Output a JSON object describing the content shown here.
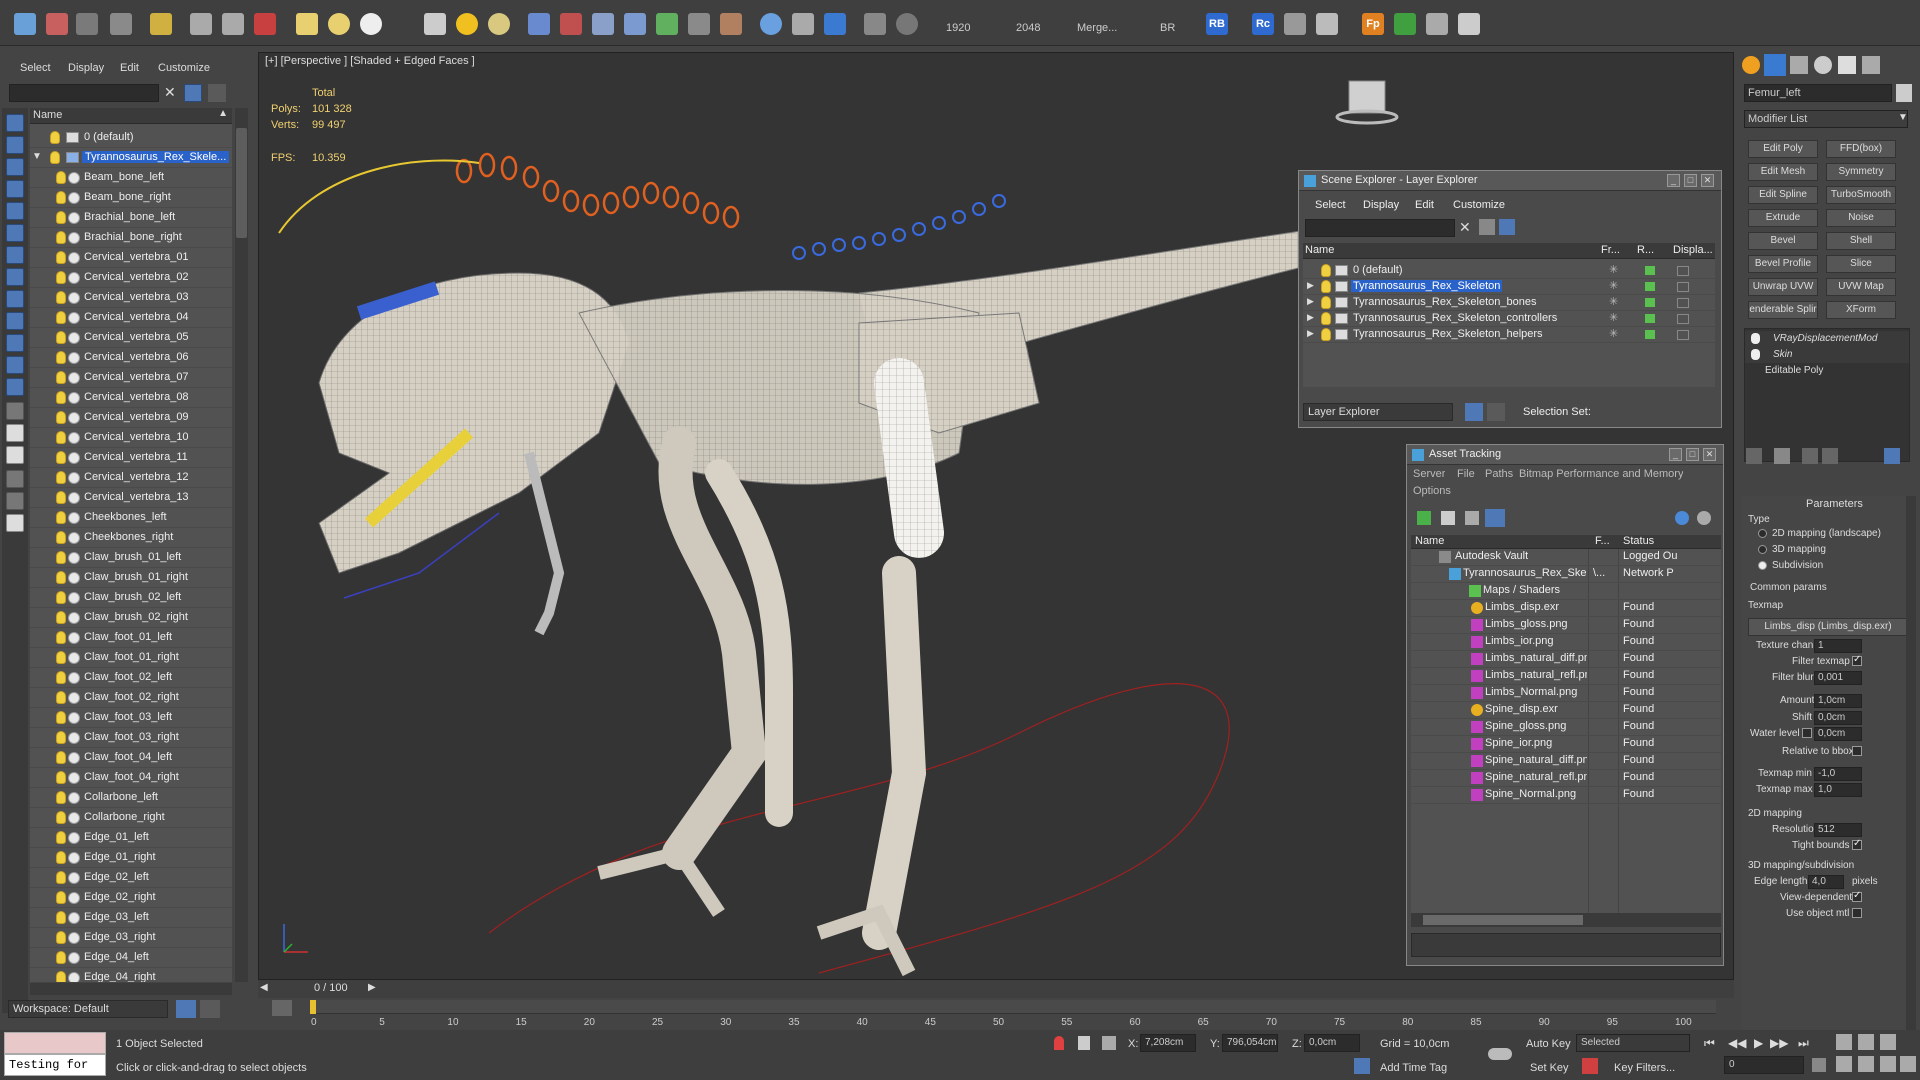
{
  "toolbar": {
    "render_width": "1920",
    "render_height": "2048",
    "merge_label": "Merge...",
    "br_label": "BR",
    "rb_label": "RB",
    "rc_label": "Rc",
    "fp_label": "Fp"
  },
  "scene_explorer_left": {
    "menu": [
      "Select",
      "Display",
      "Edit",
      "Customize"
    ],
    "column_name": "Name",
    "layer_default": "0 (default)",
    "selected_layer": "Tyrannosaurus_Rex_Skele...",
    "objects": [
      "Beam_bone_left",
      "Beam_bone_right",
      "Brachial_bone_left",
      "Brachial_bone_right",
      "Cervical_vertebra_01",
      "Cervical_vertebra_02",
      "Cervical_vertebra_03",
      "Cervical_vertebra_04",
      "Cervical_vertebra_05",
      "Cervical_vertebra_06",
      "Cervical_vertebra_07",
      "Cervical_vertebra_08",
      "Cervical_vertebra_09",
      "Cervical_vertebra_10",
      "Cervical_vertebra_11",
      "Cervical_vertebra_12",
      "Cervical_vertebra_13",
      "Cheekbones_left",
      "Cheekbones_right",
      "Claw_brush_01_left",
      "Claw_brush_01_right",
      "Claw_brush_02_left",
      "Claw_brush_02_right",
      "Claw_foot_01_left",
      "Claw_foot_01_right",
      "Claw_foot_02_left",
      "Claw_foot_02_right",
      "Claw_foot_03_left",
      "Claw_foot_03_right",
      "Claw_foot_04_left",
      "Claw_foot_04_right",
      "Collarbone_left",
      "Collarbone_right",
      "Edge_01_left",
      "Edge_01_right",
      "Edge_02_left",
      "Edge_02_right",
      "Edge_03_left",
      "Edge_03_right",
      "Edge_04_left",
      "Edge_04_right"
    ],
    "workspace": "Workspace: Default"
  },
  "viewport": {
    "label": "[+] [Perspective ] [Shaded + Edged Faces ]",
    "stats_total": "Total",
    "polys_label": "Polys:",
    "polys_value": "101 328",
    "verts_label": "Verts:",
    "verts_value": "99 497",
    "fps_label": "FPS:",
    "fps_value": "10.359",
    "frame_counter": "0 / 100"
  },
  "layer_explorer": {
    "title": "Scene Explorer - Layer Explorer",
    "menu": [
      "Select",
      "Display",
      "Edit",
      "Customize"
    ],
    "columns": [
      "Name",
      "Fr...",
      "R...",
      "Displa..."
    ],
    "layers": [
      "0 (default)",
      "Tyrannosaurus_Rex_Skeleton",
      "Tyrannosaurus_Rex_Skeleton_bones",
      "Tyrannosaurus_Rex_Skeleton_controllers",
      "Tyrannosaurus_Rex_Skeleton_helpers"
    ],
    "footer_dropdown": "Layer Explorer",
    "selection_set": "Selection Set:"
  },
  "asset_tracking": {
    "title": "Asset Tracking",
    "menu1": [
      "Server",
      "File",
      "Paths",
      "Bitmap Performance and Memory"
    ],
    "menu2": "Options",
    "columns": [
      "Name",
      "F...",
      "Status"
    ],
    "vault": "Autodesk Vault",
    "vault_status": "Logged Ou",
    "scene_file": "Tyrannosaurus_Rex_Skeleton....",
    "scene_path": "\\...",
    "scene_status": "Network P",
    "maps_group": "Maps / Shaders",
    "files": [
      {
        "name": "Limbs_disp.exr",
        "status": "Found",
        "kind": "exr"
      },
      {
        "name": "Limbs_gloss.png",
        "status": "Found",
        "kind": "png"
      },
      {
        "name": "Limbs_ior.png",
        "status": "Found",
        "kind": "png"
      },
      {
        "name": "Limbs_natural_diff.png",
        "status": "Found",
        "kind": "png"
      },
      {
        "name": "Limbs_natural_refl.png",
        "status": "Found",
        "kind": "png"
      },
      {
        "name": "Limbs_Normal.png",
        "status": "Found",
        "kind": "png"
      },
      {
        "name": "Spine_disp.exr",
        "status": "Found",
        "kind": "exr"
      },
      {
        "name": "Spine_gloss.png",
        "status": "Found",
        "kind": "png"
      },
      {
        "name": "Spine_ior.png",
        "status": "Found",
        "kind": "png"
      },
      {
        "name": "Spine_natural_diff.png",
        "status": "Found",
        "kind": "png"
      },
      {
        "name": "Spine_natural_refl.png",
        "status": "Found",
        "kind": "png"
      },
      {
        "name": "Spine_Normal.png",
        "status": "Found",
        "kind": "png"
      }
    ]
  },
  "command_panel": {
    "object_name": "Femur_left",
    "modifier_list": "Modifier List",
    "buttons": [
      [
        "Edit Poly",
        "FFD(box)"
      ],
      [
        "Edit Mesh",
        "Symmetry"
      ],
      [
        "Edit Spline",
        "TurboSmooth"
      ],
      [
        "Extrude",
        "Noise"
      ],
      [
        "Bevel",
        "Shell"
      ],
      [
        "Bevel Profile",
        "Slice"
      ],
      [
        "Unwrap UVW",
        "UVW Map"
      ],
      [
        "enderable Splir",
        "XForm"
      ]
    ],
    "stack": [
      "VRayDisplacementMod",
      "Skin",
      "Editable Poly"
    ],
    "parameters": "Parameters",
    "type_label": "Type",
    "type_options": [
      "2D mapping (landscape)",
      "3D mapping",
      "Subdivision"
    ],
    "common_params": "Common params",
    "texmap_label": "Texmap",
    "texmap_value": "Limbs_disp (Limbs_disp.exr)",
    "texture_chan_label": "Texture chan",
    "texture_chan": "1",
    "filter_texmap": "Filter texmap",
    "filter_blur_label": "Filter blur",
    "filter_blur": "0,001",
    "amount_label": "Amount",
    "amount": "1,0cm",
    "shift_label": "Shift",
    "shift": "0,0cm",
    "water_level_label": "Water level",
    "water_level": "0,0cm",
    "relative_bbox": "Relative to bbox",
    "texmap_min_label": "Texmap min",
    "texmap_min": "-1,0",
    "texmap_max_label": "Texmap max",
    "texmap_max": "1,0",
    "mapping2d": "2D mapping",
    "resolution_label": "Resolution",
    "resolution": "512",
    "tight_bounds": "Tight bounds",
    "mapping3d": "3D mapping/subdivision",
    "edge_length_label": "Edge length",
    "edge_length": "4,0",
    "pixels": "pixels",
    "view_dependent": "View-dependent",
    "use_object_mtl": "Use object mtl"
  },
  "timeline": {
    "ticks": [
      "0",
      "5",
      "10",
      "15",
      "20",
      "25",
      "30",
      "35",
      "40",
      "45",
      "50",
      "55",
      "60",
      "65",
      "70",
      "75",
      "80",
      "85",
      "90",
      "95",
      "100"
    ]
  },
  "status": {
    "maxscript": "Testing for",
    "selected": "1 Object Selected",
    "prompt": "Click or click-and-drag to select objects",
    "x_label": "X:",
    "x_value": "7,208cm",
    "y_label": "Y:",
    "y_value": "796,054cm",
    "z_label": "Z:",
    "z_value": "0,0cm",
    "grid": "Grid = 10,0cm",
    "add_time_tag": "Add Time Tag",
    "auto_key": "Auto Key",
    "set_key": "Set Key",
    "selected_dropdown": "Selected",
    "key_filters": "Key Filters...",
    "frame_value": "0"
  }
}
